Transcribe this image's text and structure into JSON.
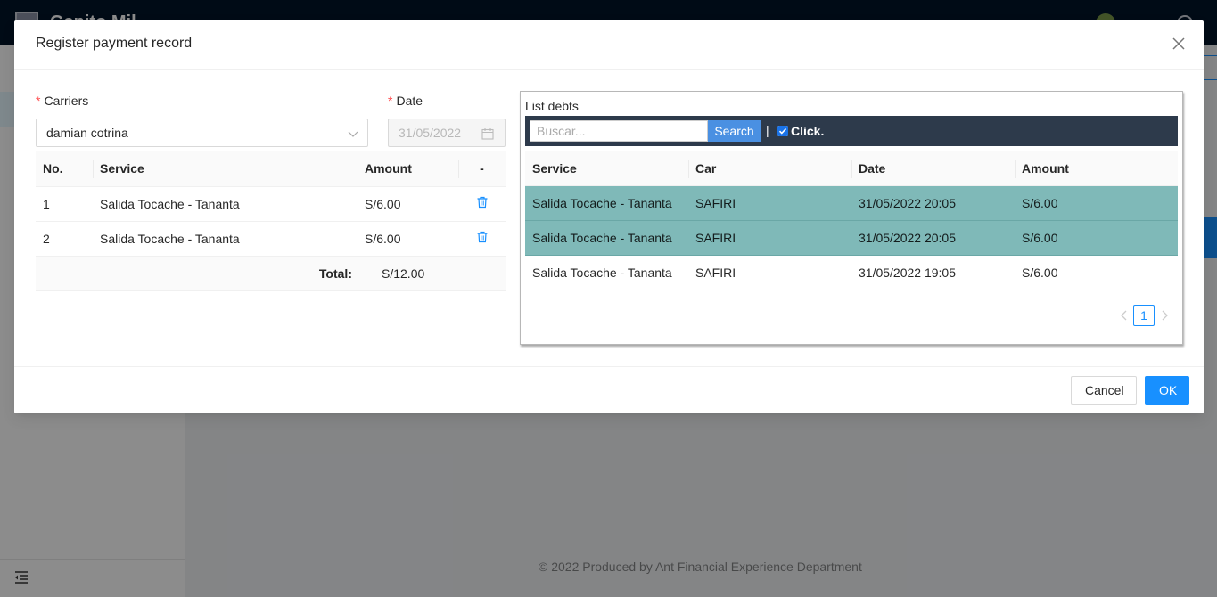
{
  "background": {
    "app_title": "Ganito Mil",
    "footer": "© 2022 Produced by Ant Financial Experience Department"
  },
  "modal": {
    "title": "Register payment record",
    "carriers_label": "Carriers",
    "carrier_value": "damian cotrina",
    "date_label": "Date",
    "date_value": "31/05/2022",
    "left_table": {
      "headers": [
        "No.",
        "Service",
        "Amount",
        "-"
      ],
      "rows": [
        {
          "no": "1",
          "service": "Salida Tocache - Tananta",
          "amount": "S/6.00"
        },
        {
          "no": "2",
          "service": "Salida Tocache - Tananta",
          "amount": "S/6.00"
        }
      ],
      "total_label": "Total:",
      "total_value": "S/12.00"
    },
    "debts": {
      "title": "List debts",
      "search_placeholder": "Buscar...",
      "search_button": "Search",
      "separator": "|",
      "click_label": "Click.",
      "headers": [
        "Service",
        "Car",
        "Date",
        "Amount"
      ],
      "rows": [
        {
          "service": "Salida Tocache - Tananta",
          "car": "SAFIRI",
          "date": "31/05/2022 20:05",
          "amount": "S/6.00",
          "selected": true
        },
        {
          "service": "Salida Tocache - Tananta",
          "car": "SAFIRI",
          "date": "31/05/2022 20:05",
          "amount": "S/6.00",
          "selected": true
        },
        {
          "service": "Salida Tocache - Tananta",
          "car": "SAFIRI",
          "date": "31/05/2022 19:05",
          "amount": "S/6.00",
          "selected": false
        }
      ],
      "current_page": "1"
    },
    "cancel_label": "Cancel",
    "ok_label": "OK"
  },
  "colors": {
    "primary": "#1890ff",
    "selected_row": "#7fb9b8",
    "search_bar": "#2d3a4b",
    "required": "#ff4d4f"
  }
}
